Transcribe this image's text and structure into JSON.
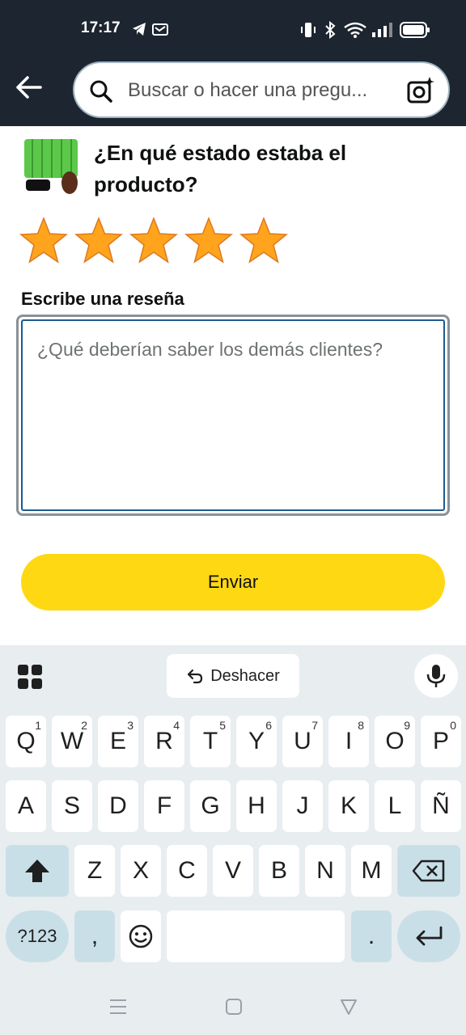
{
  "status": {
    "time": "17:17"
  },
  "search": {
    "placeholder": "Buscar o hacer una pregu..."
  },
  "review": {
    "question": "¿En qué estado estaba el producto?",
    "rating": 5,
    "rating_max": 5,
    "label": "Escribe una reseña",
    "placeholder": "¿Qué deberían saber los demás clientes?",
    "submit": "Enviar"
  },
  "keyboard": {
    "undo": "Deshacer",
    "row1": [
      {
        "k": "Q",
        "n": "1"
      },
      {
        "k": "W",
        "n": "2"
      },
      {
        "k": "E",
        "n": "3"
      },
      {
        "k": "R",
        "n": "4"
      },
      {
        "k": "T",
        "n": "5"
      },
      {
        "k": "Y",
        "n": "6"
      },
      {
        "k": "U",
        "n": "7"
      },
      {
        "k": "I",
        "n": "8"
      },
      {
        "k": "O",
        "n": "9"
      },
      {
        "k": "P",
        "n": "0"
      }
    ],
    "row2": [
      "A",
      "S",
      "D",
      "F",
      "G",
      "H",
      "J",
      "K",
      "L",
      "Ñ"
    ],
    "row3": [
      "Z",
      "X",
      "C",
      "V",
      "B",
      "N",
      "M"
    ],
    "symbols": "?123",
    "comma": ",",
    "period": "."
  },
  "colors": {
    "header": "#1c2530",
    "star": "#ffa41c",
    "button": "#ffd814",
    "focus": "#1f5a8c",
    "keyboard": "#e8edf0"
  }
}
